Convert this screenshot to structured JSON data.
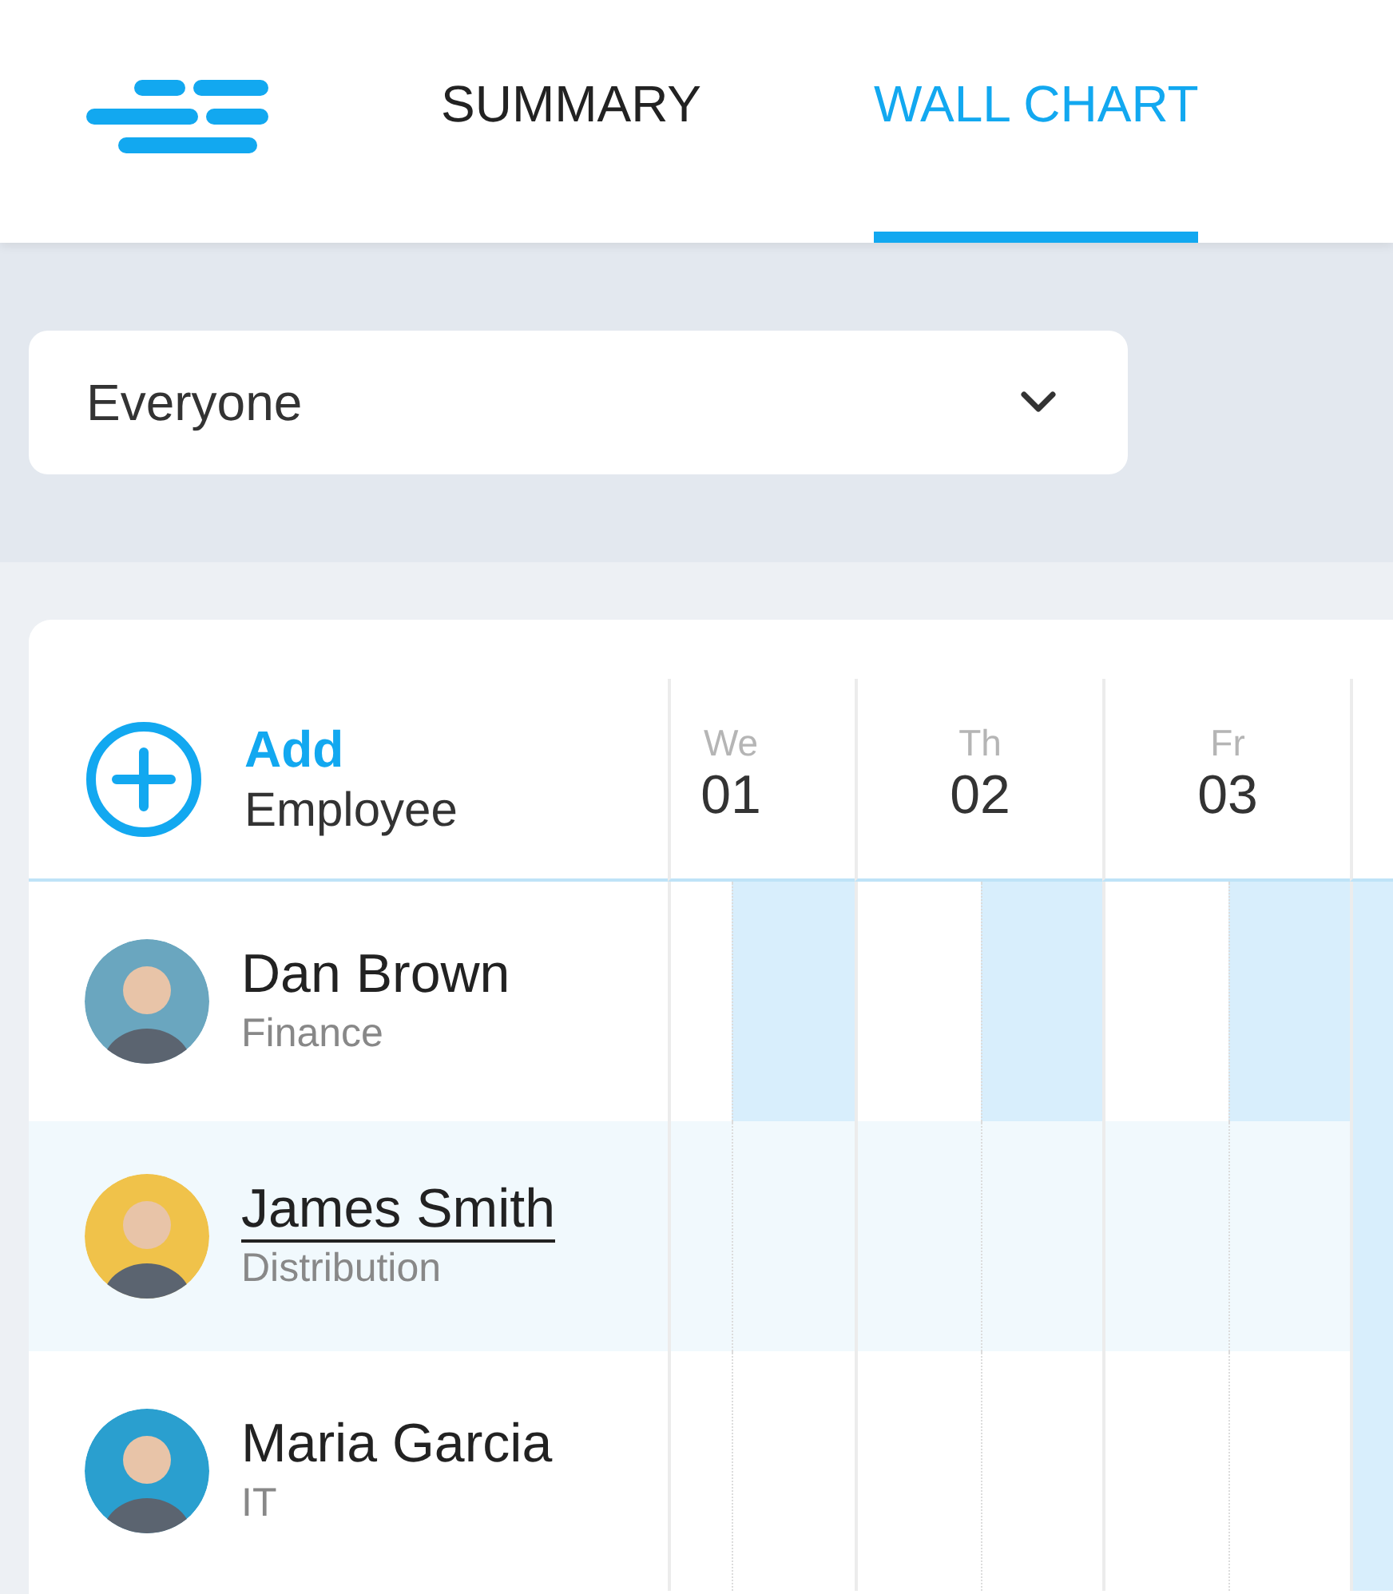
{
  "nav": {
    "tabs": [
      {
        "label": "SUMMARY",
        "selected": false
      },
      {
        "label": "WALL CHART",
        "selected": true
      }
    ]
  },
  "filter": {
    "value": "Everyone"
  },
  "add_button": {
    "line_1": "Add",
    "line_2": "Employee"
  },
  "days": [
    {
      "weekday": "We",
      "date": "01"
    },
    {
      "weekday": "Th",
      "date": "02"
    },
    {
      "weekday": "Fr",
      "date": "03"
    }
  ],
  "employees": [
    {
      "name": "Dan Brown",
      "department": "Finance",
      "hovered": false,
      "color": "#6aa6bf",
      "cells": [
        {
          "am": false,
          "pm": true
        },
        {
          "am": false,
          "pm": true
        },
        {
          "am": false,
          "pm": true
        },
        {
          "am": true
        }
      ]
    },
    {
      "name": "James Smith",
      "department": "Distribution",
      "hovered": true,
      "color": "#f0c24a",
      "cells": [
        {
          "am": false,
          "pm": false
        },
        {
          "am": false,
          "pm": false
        },
        {
          "am": false,
          "pm": false
        },
        {
          "am": true
        }
      ]
    },
    {
      "name": "Maria Garcia",
      "department": "IT",
      "hovered": false,
      "color": "#2a9fcf",
      "cells": [
        {
          "am": false,
          "pm": false
        },
        {
          "am": false,
          "pm": false
        },
        {
          "am": false,
          "pm": false
        },
        {
          "am": true
        }
      ]
    }
  ]
}
